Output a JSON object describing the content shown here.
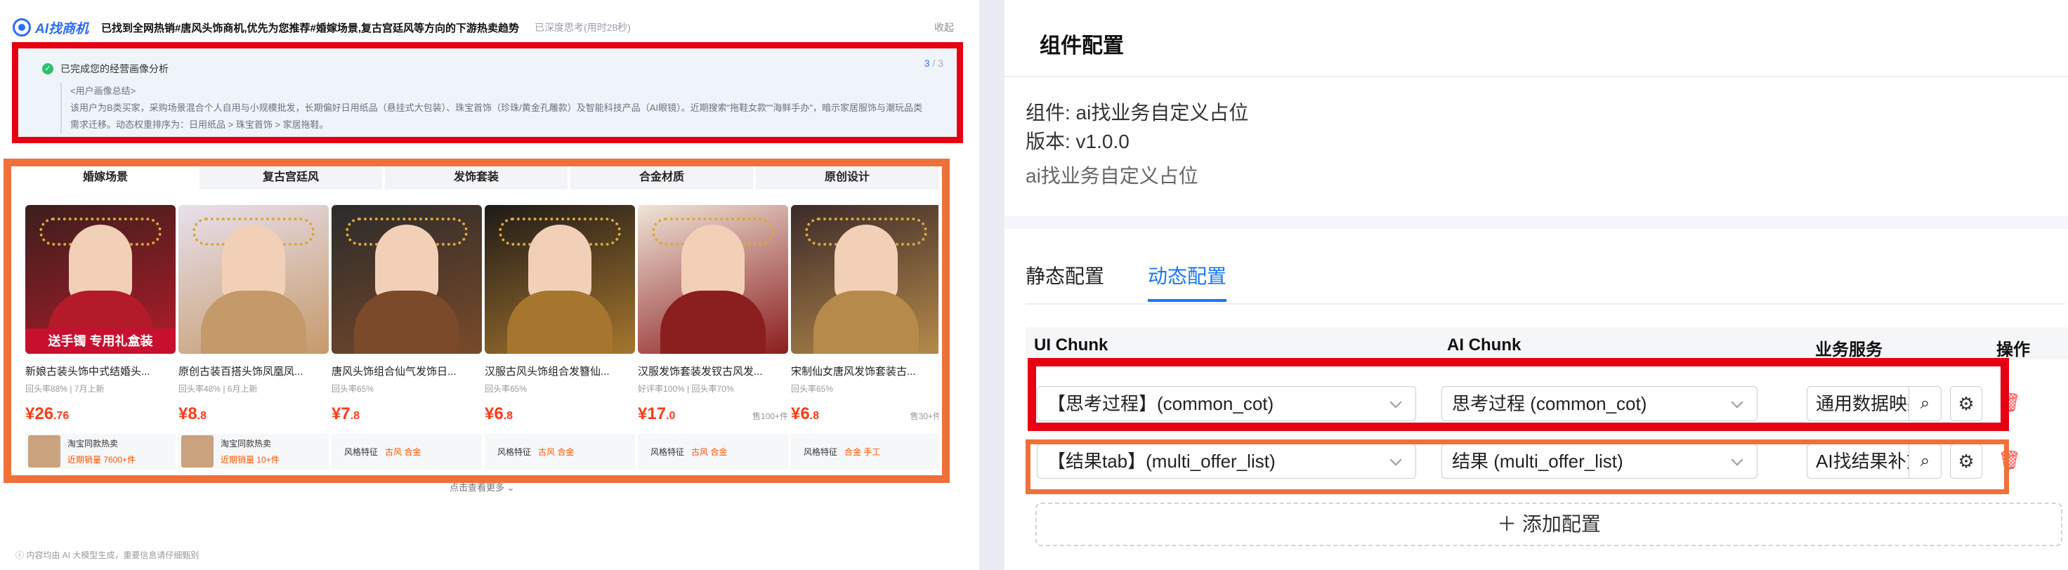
{
  "left": {
    "logo": "AI找商机",
    "title": "已找到全网热销#唐风头饰商机,优先为您推荐#婚嫁场景,复古宫廷风等方向的下游热卖趋势",
    "status": "已深度思考(用时28秒)",
    "collapse": "收起",
    "analysis": {
      "title": "已完成您的经营画像分析",
      "count_current": "3",
      "count_total": "/ 3",
      "body_heading": "<用户画像总结>",
      "body": "该用户为B类买家，采购场景混合个人自用与小规模批发，长期偏好日用纸品（悬挂式大包装）、珠宝首饰（珍珠/黄金孔雕款）及智能科技产品（AI眼镜）。近期搜索\"拖鞋女款\"\"海鲜手办\"，暗示家居服饰与潮玩品类需求迁移。动态权重排序为：日用纸品 > 珠宝首饰 > 家居拖鞋。"
    },
    "tabs": [
      "婚嫁场景",
      "复古宫廷风",
      "发饰套装",
      "合金材质",
      "原创设计"
    ],
    "products": [
      {
        "name": "新娘古装头饰中式结婚头...",
        "meta": "回头率88% | 7月上新",
        "price_int": "¥26",
        "price_dec": ".76",
        "sold": "",
        "promo": "送手镯 专用礼盒装",
        "foot_type": "taobao",
        "foot1": "淘宝同款热卖",
        "foot2": "近期销量 7600+件",
        "tags": ""
      },
      {
        "name": "原创古装百搭头饰凤凰凤...",
        "meta": "回头率48% | 6月上新",
        "price_int": "¥8",
        "price_dec": ".8",
        "sold": "",
        "promo": "",
        "foot_type": "taobao",
        "foot1": "淘宝同款热卖",
        "foot2": "近期销量 10+件",
        "tags": ""
      },
      {
        "name": "唐风头饰组合仙气发饰日...",
        "meta": "回头率65%",
        "price_int": "¥7",
        "price_dec": ".8",
        "sold": "",
        "promo": "",
        "foot_type": "style",
        "foot1": "风格特征",
        "foot2": "",
        "tags": "古风   合金"
      },
      {
        "name": "汉服古风头饰组合发簪仙...",
        "meta": "回头率65%",
        "price_int": "¥6",
        "price_dec": ".8",
        "sold": "",
        "promo": "",
        "foot_type": "style",
        "foot1": "风格特征",
        "foot2": "",
        "tags": "古风   合金"
      },
      {
        "name": "汉服发饰套装发钗古风发...",
        "meta": "好评率100% | 回头率70%",
        "price_int": "¥17",
        "price_dec": ".0",
        "sold": "售100+件",
        "promo": "",
        "foot_type": "style",
        "foot1": "风格特征",
        "foot2": "",
        "tags": "古风   合金"
      },
      {
        "name": "宋制仙女唐风发饰套装古...",
        "meta": "回头率65%",
        "price_int": "¥6",
        "price_dec": ".8",
        "sold": "售30+件",
        "promo": "",
        "foot_type": "style",
        "foot1": "风格特征",
        "foot2": "",
        "tags": "合金   手工"
      }
    ],
    "more": "点击查看更多 ⌄",
    "note": "ⓘ 内容均由 AI 大模型生成，重要信息请仔细甄别"
  },
  "right": {
    "title": "组件配置",
    "component": "组件: ai找业务自定义占位",
    "version": "版本: v1.0.0",
    "description": "ai找业务自定义占位",
    "tabs": [
      "静态配置",
      "动态配置"
    ],
    "columns": [
      "UI Chunk",
      "AI Chunk",
      "业务服务",
      "操作"
    ],
    "rows": [
      {
        "ui": "【思考过程】(common_cot)",
        "ai": "思考过程 (common_cot)",
        "service": "通用数据映射"
      },
      {
        "ui": "【结果tab】(multi_offer_list)",
        "ai": "结果 (multi_offer_list)",
        "service": "AI找结果补充"
      }
    ],
    "add": "添加配置"
  },
  "colors": {
    "accent": "#1677ff",
    "price": "#ff3b16",
    "highlight_red": "#e60012",
    "highlight_orange": "#f0703a"
  }
}
